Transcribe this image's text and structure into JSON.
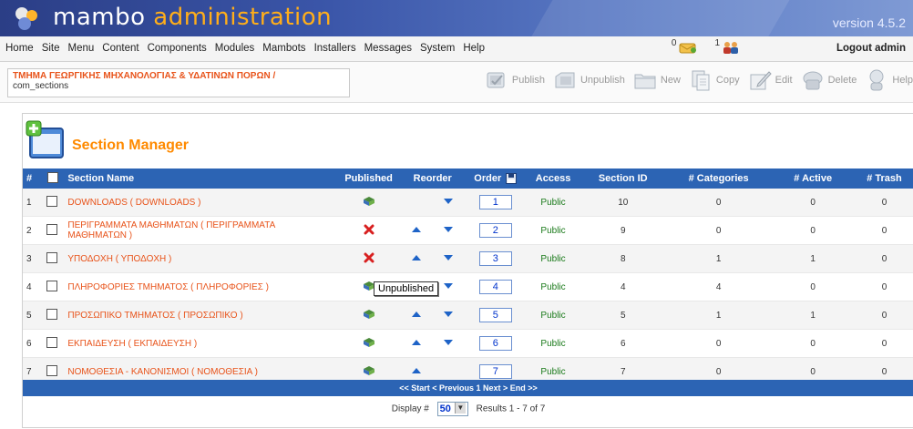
{
  "header": {
    "title_main": "mambo",
    "title_accent": "administration",
    "version": "version 4.5.2"
  },
  "menu": {
    "items": [
      "Home",
      "Site",
      "Menu",
      "Content",
      "Components",
      "Modules",
      "Mambots",
      "Installers",
      "Messages",
      "System",
      "Help"
    ],
    "messages_count": "0",
    "online_users": "1",
    "logout_label": "Logout admin"
  },
  "pathway": {
    "line1": "ΤΜΗΜΑ ΓΕΩΡΓΙΚΗΣ ΜΗΧΑΝΟΛΟΓΙΑΣ & ΥΔΑΤΙΝΩΝ ΠΟΡΩΝ /",
    "line2": "com_sections"
  },
  "toolbar": {
    "publish": "Publish",
    "unpublish": "Unpublish",
    "new": "New",
    "copy": "Copy",
    "edit": "Edit",
    "delete": "Delete",
    "help": "Help"
  },
  "section_manager": {
    "title": "Section Manager",
    "columns": {
      "num": "#",
      "name": "Section Name",
      "published": "Published",
      "reorder": "Reorder",
      "order": "Order",
      "access": "Access",
      "section_id": "Section ID",
      "categories": "# Categories",
      "active": "# Active",
      "trash": "# Trash"
    },
    "rows": [
      {
        "num": "1",
        "name": "DOWNLOADS ( DOWNLOADS )",
        "published": true,
        "up": false,
        "down": true,
        "order": "1",
        "access": "Public",
        "section_id": "10",
        "categories": "0",
        "active": "0",
        "trash": "0"
      },
      {
        "num": "2",
        "name": "ΠΕΡΙΓΡΑΜΜΑΤΑ ΜΑΘΗΜΑΤΩΝ ( ΠΕΡΙΓΡΑΜΜΑΤΑ ΜΑΘΗΜΑΤΩΝ )",
        "published": false,
        "up": true,
        "down": true,
        "order": "2",
        "access": "Public",
        "section_id": "9",
        "categories": "0",
        "active": "0",
        "trash": "0"
      },
      {
        "num": "3",
        "name": "ΥΠΟΔΟΧΗ ( ΥΠΟΔΟΧΗ )",
        "published": false,
        "up": true,
        "down": true,
        "order": "3",
        "access": "Public",
        "section_id": "8",
        "categories": "1",
        "active": "1",
        "trash": "0"
      },
      {
        "num": "4",
        "name": "ΠΛΗΡΟΦΟΡΙΕΣ ΤΜΗΜΑΤΟΣ ( ΠΛΗΡΟΦΟΡΙΕΣ )",
        "published": true,
        "up": false,
        "down": true,
        "order": "4",
        "access": "Public",
        "section_id": "4",
        "categories": "4",
        "active": "0",
        "trash": "0"
      },
      {
        "num": "5",
        "name": "ΠΡΟΣΩΠΙΚΟ ΤΜΗΜΑΤΟΣ ( ΠΡΟΣΩΠΙΚΟ )",
        "published": true,
        "up": true,
        "down": true,
        "order": "5",
        "access": "Public",
        "section_id": "5",
        "categories": "1",
        "active": "1",
        "trash": "0"
      },
      {
        "num": "6",
        "name": "ΕΚΠΑΙΔΕΥΣΗ ( ΕΚΠΑΙΔΕΥΣΗ )",
        "published": true,
        "up": true,
        "down": true,
        "order": "6",
        "access": "Public",
        "section_id": "6",
        "categories": "0",
        "active": "0",
        "trash": "0"
      },
      {
        "num": "7",
        "name": "ΝΟΜΟΘΕΣΙΑ - ΚΑΝΟΝΙΣΜΟΙ ( ΝΟΜΟΘΕΣΙΑ )",
        "published": true,
        "up": true,
        "down": false,
        "order": "7",
        "access": "Public",
        "section_id": "7",
        "categories": "0",
        "active": "0",
        "trash": "0"
      }
    ],
    "tooltip": "Unpublished",
    "pagination": "<< Start < Previous 1 Next > End >>",
    "display_label": "Display #",
    "display_value": "50",
    "results": "Results 1 - 7 of 7"
  },
  "colors": {
    "header_bar": "#2c64b4",
    "accent_orange": "#ff8a00",
    "link_orange": "#e8531a",
    "access_green": "#1a7a1a"
  }
}
